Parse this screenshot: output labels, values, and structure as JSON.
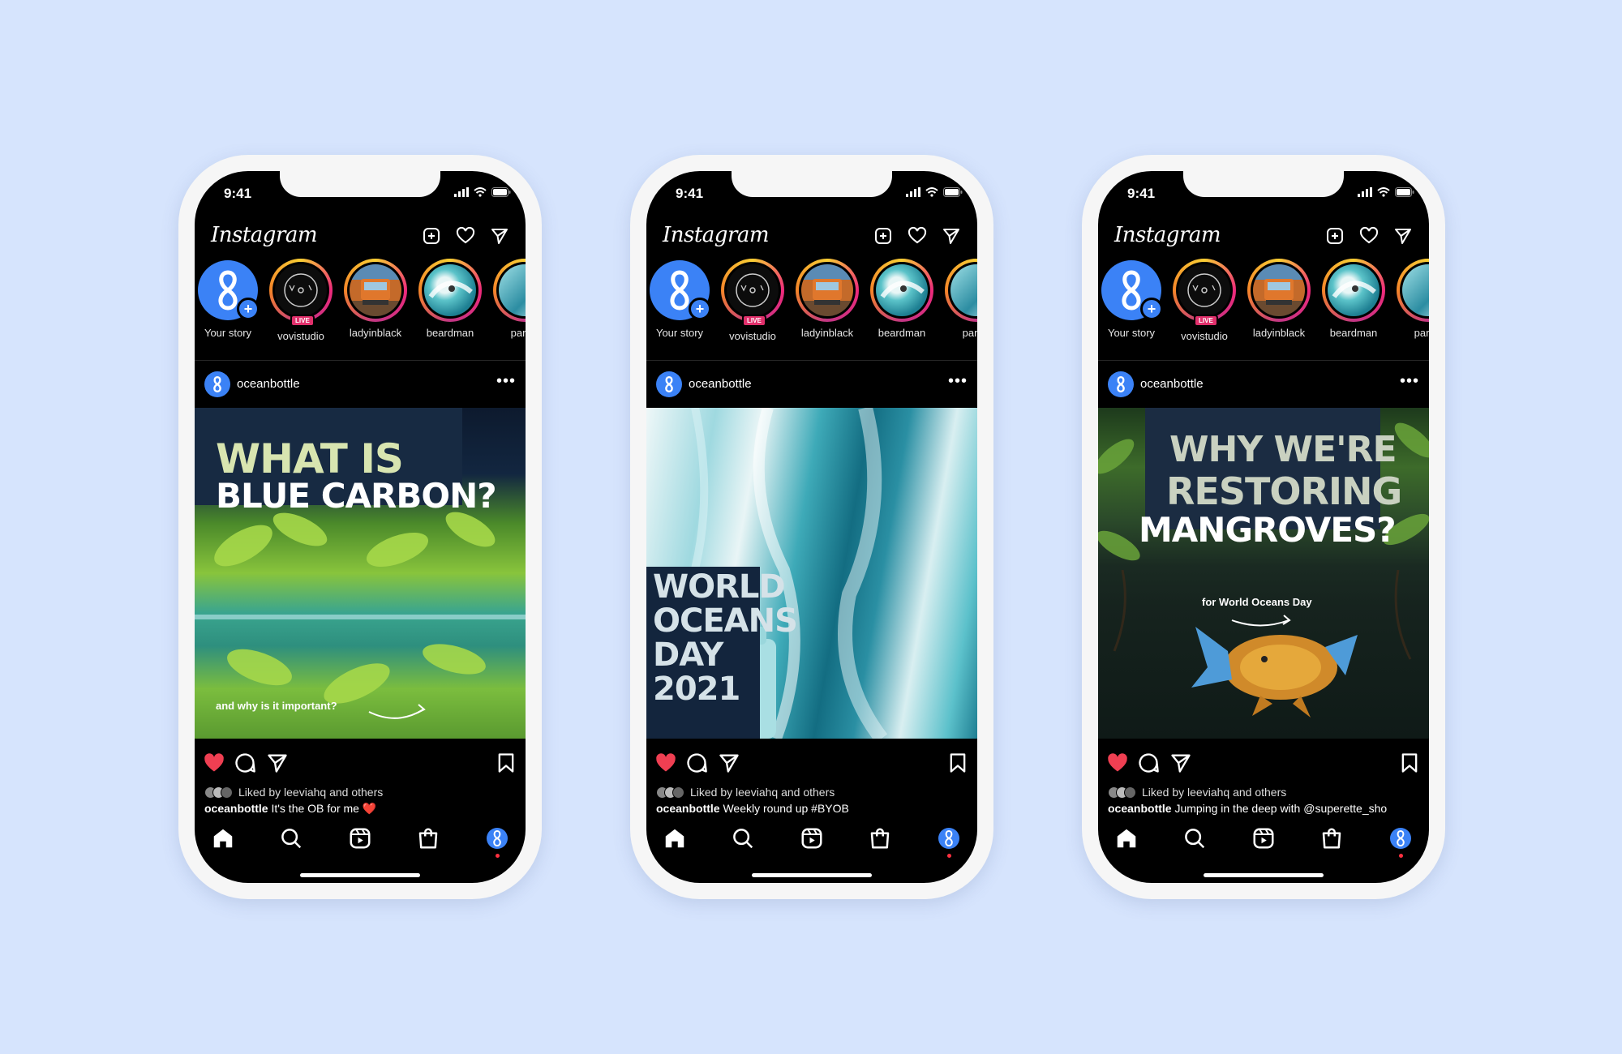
{
  "status": {
    "time": "9:41"
  },
  "app": {
    "logo": "Instagram"
  },
  "stories": [
    {
      "name": "Your story"
    },
    {
      "name": "vovistudio",
      "badge": "LIVE"
    },
    {
      "name": "ladyinblack"
    },
    {
      "name": "beardman"
    },
    {
      "name": "parziv"
    }
  ],
  "colors": {
    "background": "#d6e4fd",
    "accent": "#3b82f6",
    "like": "#ef3f52"
  },
  "phones": [
    {
      "post_user": "oceanbottle",
      "image_title_line1": "WHAT IS",
      "image_title_line2": "BLUE CARBON?",
      "image_subtitle": "and why is it important?",
      "liked_by": "Liked by leeviahq and others",
      "caption_user": "oceanbottle",
      "caption_text": "It's the OB for me ❤️"
    },
    {
      "post_user": "oceanbottle",
      "image_title_lines": [
        "WORLD",
        "OCEANS",
        "DAY",
        "2021"
      ],
      "liked_by": "Liked by leeviahq and others",
      "caption_user": "oceanbottle",
      "caption_text": "Weekly round up #BYOB"
    },
    {
      "post_user": "oceanbottle",
      "image_title_line1": "WHY WE'RE",
      "image_title_line2": "RESTORING",
      "image_title_line3": "MANGROVES?",
      "image_subtitle": "for World Oceans Day",
      "liked_by": "Liked by leeviahq and others",
      "caption_user": "oceanbottle",
      "caption_text": "Jumping in the deep with @superette_sho"
    }
  ]
}
